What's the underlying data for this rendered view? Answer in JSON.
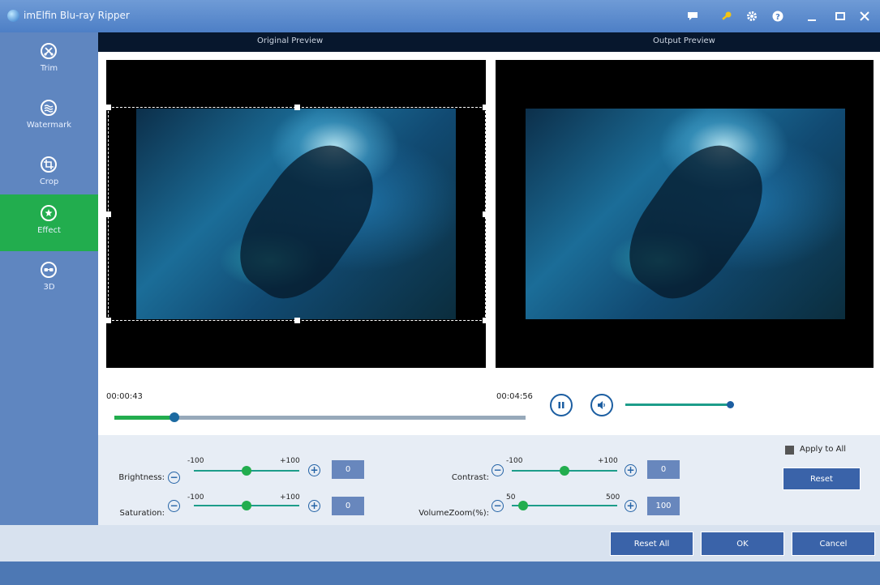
{
  "window": {
    "title": "imElfin Blu-ray Ripper"
  },
  "sidebar": {
    "items": [
      {
        "label": "Trim",
        "icon": "scissors-icon",
        "active": false
      },
      {
        "label": "Watermark",
        "icon": "watermark-icon",
        "active": false
      },
      {
        "label": "Crop",
        "icon": "crop-icon",
        "active": false
      },
      {
        "label": "Effect",
        "icon": "effect-icon",
        "active": true
      },
      {
        "label": "3D",
        "icon": "3d-glasses-icon",
        "active": false
      }
    ]
  },
  "preview": {
    "original_label": "Original Preview",
    "output_label": "Output Preview"
  },
  "playback": {
    "current_time": "00:00:43",
    "total_time": "00:04:56",
    "progress_fraction": 0.145,
    "volume_fraction": 0.97
  },
  "effects": {
    "brightness": {
      "label": "Brightness:",
      "min": "-100",
      "max": "+100",
      "value": "0"
    },
    "saturation": {
      "label": "Saturation:",
      "min": "-100",
      "max": "+100",
      "value": "0"
    },
    "contrast": {
      "label": "Contrast:",
      "min": "-100",
      "max": "+100",
      "value": "0"
    },
    "volume_zoom": {
      "label": "VolumeZoom(%):",
      "min": "50",
      "max": "500",
      "value": "100"
    }
  },
  "apply_to_all": {
    "label": "Apply to All",
    "checked": true
  },
  "buttons": {
    "reset": "Reset",
    "reset_all": "Reset All",
    "ok": "OK",
    "cancel": "Cancel"
  },
  "colors": {
    "accent_green": "#22ad4e",
    "sidebar_blue": "#5f86c0",
    "button_blue": "#3a63a9"
  }
}
